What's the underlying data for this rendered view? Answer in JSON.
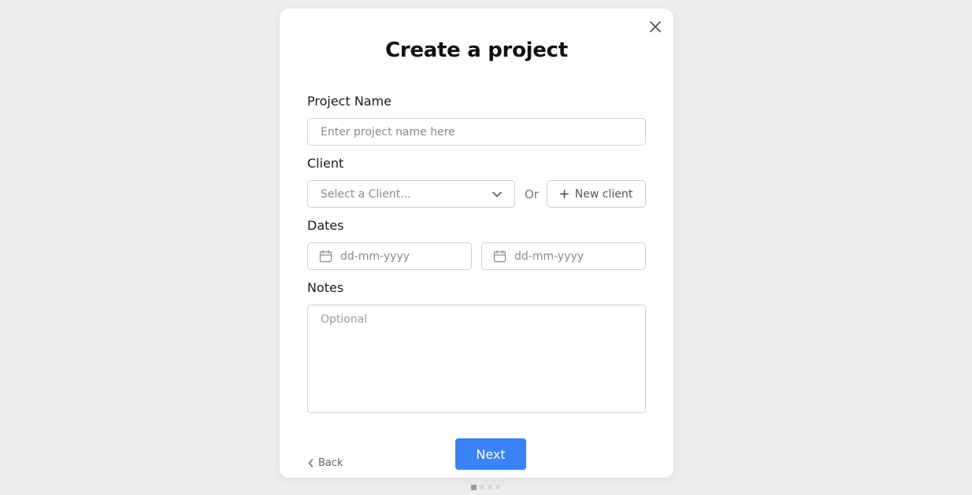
{
  "modal": {
    "title": "Create a project",
    "project_name": {
      "label": "Project Name",
      "placeholder": "Enter project name here",
      "value": ""
    },
    "client": {
      "label": "Client",
      "select_placeholder": "Select a Client...",
      "or_text": "Or",
      "new_client_label": "New client"
    },
    "dates": {
      "label": "Dates",
      "start_placeholder": "dd-mm-yyyy",
      "end_placeholder": "dd-mm-yyyy"
    },
    "notes": {
      "label": "Notes",
      "placeholder": "Optional",
      "value": ""
    },
    "footer": {
      "back_label": "Back",
      "next_label": "Next"
    }
  },
  "pagination": {
    "total_steps": 4,
    "current_step": 1
  },
  "icons": {
    "close": "close-icon",
    "dropdown": "chevron-down-icon",
    "add": "plus-icon",
    "calendar": "calendar-icon",
    "back": "chevron-left-icon"
  },
  "colors": {
    "primary": "#3b82f6",
    "background": "#eeeeee",
    "modal_background": "#ffffff",
    "border": "#cfcfcf"
  }
}
